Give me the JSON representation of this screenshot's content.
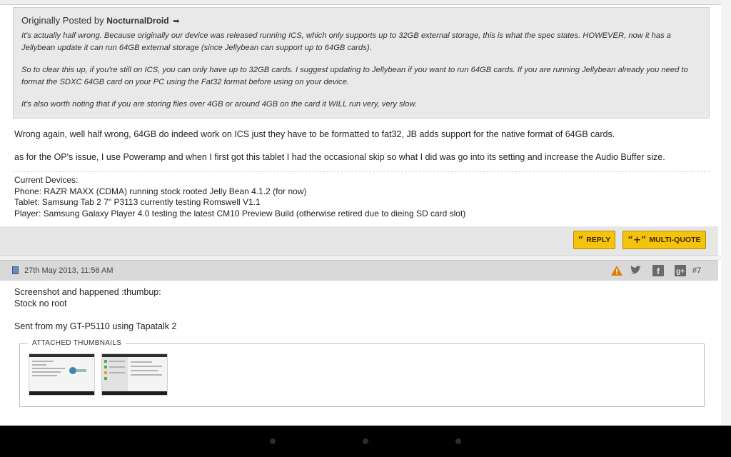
{
  "quote": {
    "prefix": "Originally Posted by",
    "author": "NocturnalDroid",
    "arrow": "➡",
    "paragraphs": [
      "It's actually half wrong. Because originally our device was released running ICS, which only supports up to 32GB external storage, this is what the spec states. HOWEVER, now it has a Jellybean update it can run 64GB external storage (since Jellybean can support up to 64GB cards).",
      "So to clear this up, if you're still on ICS, you can only have up to 32GB cards. I suggest updating to Jellybean if you want to run 64GB cards. If you are running Jellybean already you need to format the SDXC 64GB card on your PC using the Fat32 format before using on your device.",
      "It's also worth noting that if you are storing files over 4GB or around 4GB on the card it WILL run very, very slow."
    ]
  },
  "post1": {
    "lines": [
      "Wrong again, well half wrong, 64GB do indeed work on ICS just they have to be formatted to fat32, JB adds support for the native format of 64GB cards.",
      "as for the OP's issue, I use Poweramp and when I first got this tablet I had the occasional skip so what I did was go into its setting and increase the Audio Buffer size."
    ],
    "signature": [
      "Current Devices:",
      "Phone: RAZR MAXX (CDMA) running stock rooted Jelly Bean 4.1.2 (for now)",
      "Tablet: Samsung Tab 2 7\" P3113 currently testing Romswell V1.1",
      "Player: Samsung Galaxy Player 4.0 testing the latest CM10 Preview Build (otherwise retired due to dieing SD card slot)"
    ]
  },
  "actions": {
    "reply_icon": "“",
    "reply_label": "REPLY",
    "multi_icon": "“+”",
    "multi_label": "MULTI-QUOTE"
  },
  "post2": {
    "date": "27th May 2013, 11:56 AM",
    "number": "#7",
    "header_icons": [
      "warning-icon",
      "twitter-icon",
      "facebook-icon",
      "google-plus-icon"
    ],
    "facebook_glyph": "f",
    "gplus_glyph": "g+",
    "lines": [
      "Screenshot and happened :thumbup:",
      "Stock no root",
      "Sent from my GT-P5110 using Tapatalk 2"
    ],
    "attachments_label": "ATTACHED THUMBNAILS"
  },
  "colors": {
    "button_yellow": "#f5c30c",
    "quote_bg": "#e9e9e9",
    "post_header_bg": "#d9d9d9",
    "warning_orange": "#e07b00"
  }
}
